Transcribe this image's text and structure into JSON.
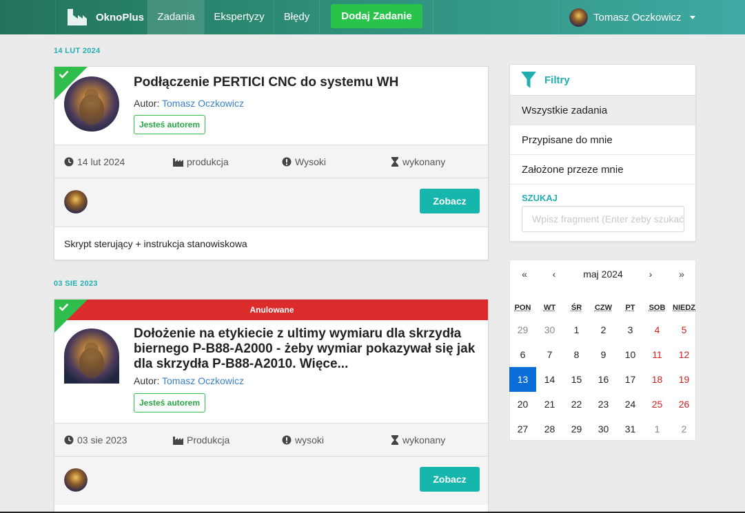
{
  "nav": {
    "brand": "OknoPlus",
    "links": [
      "Zadania",
      "Ekspertyzy",
      "Błędy"
    ],
    "add_button": "Dodaj Zadanie",
    "user_name": "Tomasz Oczkowicz"
  },
  "tasks": [
    {
      "date_header": "14 LUT 2024",
      "title": "Podłączenie PERTICI CNC do systemu WH",
      "author_label": "Autor:",
      "author": "Tomasz Oczkowicz",
      "badge": "Jesteś autorem",
      "date": "14 lut 2024",
      "category": "produkcja",
      "priority": "Wysoki",
      "status": "wykonany",
      "button": "Zobacz",
      "description": "Skrypt sterujący + instrukcja stanowiskowa"
    },
    {
      "date_header": "03 SIE 2023",
      "cancel_label": "Anulowane",
      "title": "Dołożenie na etykiecie z ultimy wymiaru dla skrzydła biernego P-B88-A2000 - żeby wymiar pokazywał się jak dla skrzydła P-B88-A2010. Więce...",
      "author_label": "Autor:",
      "author": "Tomasz Oczkowicz",
      "badge": "Jesteś autorem",
      "date": "03 sie 2023",
      "category": "Produkcja",
      "priority": "wysoki",
      "status": "wykonany",
      "button": "Zobacz"
    }
  ],
  "filters": {
    "title": "Filtry",
    "items": [
      "Wszystkie zadania",
      "Przypisane do mnie",
      "Założone przeze mnie"
    ],
    "search_label": "SZUKAJ",
    "search_placeholder": "Wpisz fragment (Enter żeby szukać)"
  },
  "calendar": {
    "nav": [
      "«",
      "‹",
      "›",
      "»"
    ],
    "month": "maj 2024",
    "weekdays": [
      "PON",
      "WT",
      "ŚR",
      "CZW",
      "PT",
      "SOB",
      "NIEDZ"
    ],
    "weeks": [
      [
        "29",
        "30",
        "1",
        "2",
        "3",
        "4",
        "5"
      ],
      [
        "6",
        "7",
        "8",
        "9",
        "10",
        "11",
        "12"
      ],
      [
        "13",
        "14",
        "15",
        "16",
        "17",
        "18",
        "19"
      ],
      [
        "20",
        "21",
        "22",
        "23",
        "24",
        "25",
        "26"
      ],
      [
        "27",
        "28",
        "29",
        "30",
        "31",
        "1",
        "2"
      ]
    ],
    "today": "13"
  },
  "colors": {
    "accent": "#21aeb1",
    "success": "#28c34a",
    "danger": "#db2b2b",
    "today": "#0b6ed8"
  }
}
